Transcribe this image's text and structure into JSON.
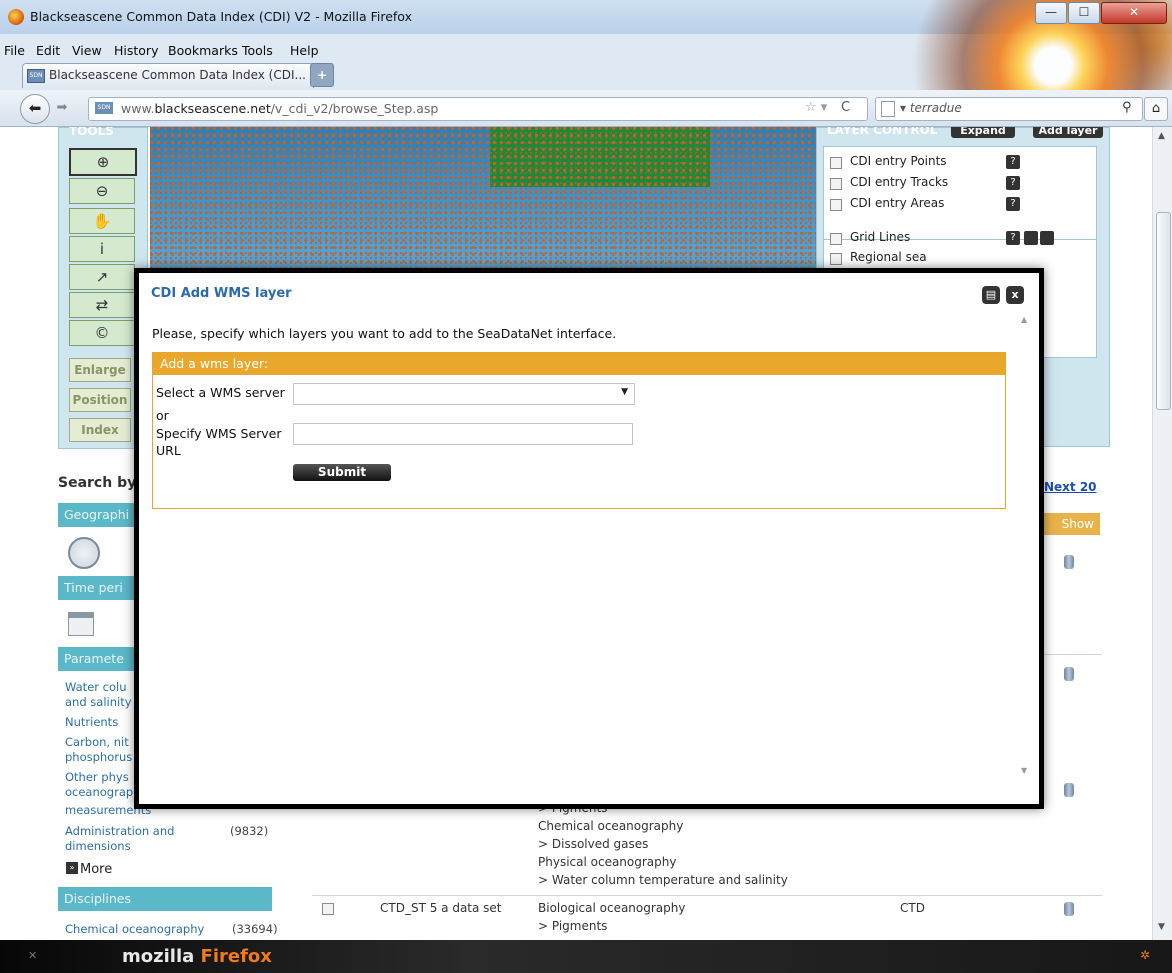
{
  "window": {
    "title": "Blackseascene Common Data Index (CDI) V2 - Mozilla Firefox"
  },
  "menu": [
    "File",
    "Edit",
    "View",
    "History",
    "Bookmarks",
    "Tools",
    "Help"
  ],
  "tab": {
    "title": "Blackseascene Common Data Index (CDI..."
  },
  "url": {
    "prefix": "www.",
    "domain": "blackseascene.net",
    "path": "/v_cdi_v2/browse_Step.asp"
  },
  "search": {
    "engine": "terradue"
  },
  "tools": {
    "title": "TOOLS",
    "buttons": [
      "Enlarge",
      "Position",
      "Index"
    ]
  },
  "layer_control": {
    "title": "LAYER CONTROL",
    "expand_label": "Expand",
    "add_layer_label": "Add layer",
    "layers": [
      "CDI entry Points",
      "CDI entry Tracks",
      "CDI entry Areas",
      "Grid Lines",
      "Regional sea"
    ],
    "help": "?"
  },
  "search_panel": {
    "search_by": "Search by",
    "geographic": "Geographi",
    "time_period": "Time peri",
    "parameters": "Paramete",
    "param_links": [
      "Water colu",
      "and salinity",
      "Nutrients",
      "Carbon, nit",
      "phosphorus",
      "Other phys",
      "oceanograp",
      "measurements",
      "Administration and",
      "dimensions"
    ],
    "admin_count": "(9832)",
    "more": "More",
    "disciplines": "Disciplines",
    "discipline_item": "Chemical oceanography",
    "discipline_count": "(33694)"
  },
  "results": {
    "next": "Next 20",
    "show_header": "Show",
    "rows_text": [
      "> Pigments",
      "Chemical oceanography",
      "> Dissolved gases",
      "Physical oceanography",
      "> Water column temperature and salinity"
    ],
    "last_row": {
      "name": "CTD_ST 5 a data set",
      "discipline": "Biological oceanography",
      "sub": "> Pigments",
      "instrument": "CTD"
    }
  },
  "modal": {
    "title": "CDI Add WMS layer",
    "intro": "Please, specify which layers you want to add to the SeaDataNet interface.",
    "box_header": "Add a wms layer:",
    "select_label": "Select a WMS server",
    "or_label": "or",
    "url_label_1": "Specify WMS Server",
    "url_label_2": "URL",
    "select_value": "",
    "url_value": "",
    "submit": "Submit"
  },
  "statusbar": {
    "brand_1": "mozilla",
    "brand_2": "Firefox"
  }
}
